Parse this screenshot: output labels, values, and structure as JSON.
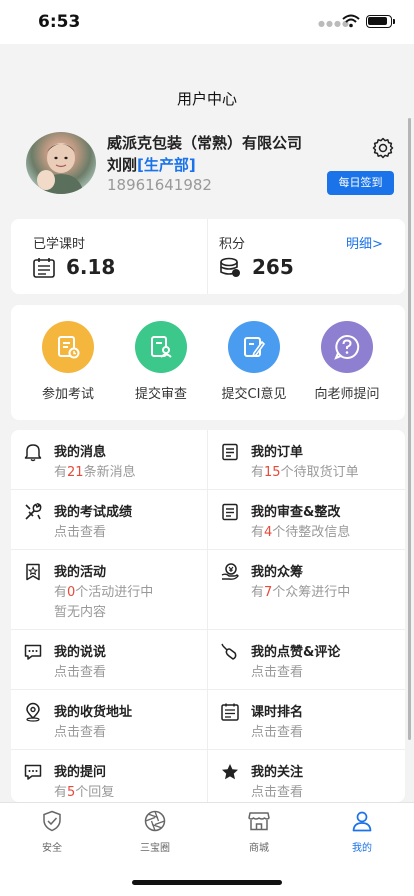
{
  "status": {
    "time": "6:53"
  },
  "nav": {
    "title": "用户中心"
  },
  "profile": {
    "company": "威派克包装（常熟）有限公司",
    "name": "刘刚",
    "department": "[生产部]",
    "phone": "18961641982",
    "checkin_label": "每日签到"
  },
  "stats": {
    "hours_label": "已学课时",
    "hours_value": "6.18",
    "points_label": "积分",
    "points_value": "265",
    "detail_label": "明细>"
  },
  "actions": [
    {
      "label": "参加考试",
      "icon": "exam-icon",
      "color": "#f5b63e"
    },
    {
      "label": "提交审查",
      "icon": "review-icon",
      "color": "#3cc78b"
    },
    {
      "label": "提交CI意见",
      "icon": "edit-icon",
      "color": "#4a9cf0"
    },
    {
      "label": "向老师提问",
      "icon": "question-icon",
      "color": "#8e7fd0"
    }
  ],
  "menu": [
    {
      "title": "我的消息",
      "sub_pre": "有",
      "sub_num": "21",
      "sub_post": "条新消息",
      "icon": "bell-icon"
    },
    {
      "title": "我的订单",
      "sub_pre": "有",
      "sub_num": "15",
      "sub_post": "个待取货订单",
      "icon": "order-icon"
    },
    {
      "title": "我的考试成绩",
      "sub": "点击查看",
      "icon": "tools-icon"
    },
    {
      "title": "我的审查&整改",
      "sub_pre": "有",
      "sub_num": "4",
      "sub_post": "个待整改信息",
      "icon": "audit-icon"
    },
    {
      "title": "我的活动",
      "sub_pre": "有",
      "sub_num": "0",
      "sub_post": "个活动进行中",
      "sub2": "暂无内容",
      "icon": "activity-icon"
    },
    {
      "title": "我的众筹",
      "sub_pre": "有",
      "sub_num": "7",
      "sub_post": "个众筹进行中",
      "icon": "crowdfund-icon"
    },
    {
      "title": "我的说说",
      "sub": "点击查看",
      "icon": "chat-icon"
    },
    {
      "title": "我的点赞&评论",
      "sub": "点击查看",
      "icon": "like-icon"
    },
    {
      "title": "我的收货地址",
      "sub": "点击查看",
      "icon": "location-icon"
    },
    {
      "title": "课时排名",
      "sub": "点击查看",
      "icon": "ranking-icon"
    },
    {
      "title": "我的提问",
      "sub_pre": "有",
      "sub_num": "5",
      "sub_post": "个回复",
      "icon": "question-chat-icon"
    },
    {
      "title": "我的关注",
      "sub": "点击查看",
      "icon": "star-icon"
    }
  ],
  "tabs": [
    {
      "label": "安全",
      "icon": "shield-icon"
    },
    {
      "label": "三宝圈",
      "icon": "aperture-icon"
    },
    {
      "label": "商城",
      "icon": "store-icon"
    },
    {
      "label": "我的",
      "icon": "person-icon",
      "active": true
    }
  ],
  "colors": {
    "accent": "#1a73e8",
    "highlight": "#e64a3b"
  }
}
